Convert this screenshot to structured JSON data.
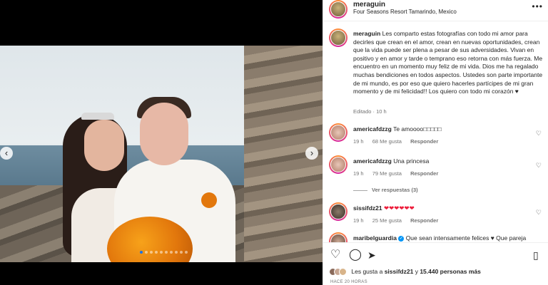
{
  "post": {
    "username": "meraguin",
    "location": "Four Seasons Resort Tamarindo, Mexico",
    "more_label": "•••",
    "caption": "Les comparto estas fotografías con todo mi amor para decirles que crean en el amor, crean en nuevas oportunidades, crean que la vida puede ser plena a pesar de sus adversidades. Vivan en positivo y en amor y tarde o temprano eso retorna con más fuerza. Me encuentro en un momento muy feliz de mi vida. Dios me ha regalado muchas bendiciones en todos aspectos. Ustedes son parte importante de mi mundo, es por eso que quiero hacerles partícipes de mi gran momento y de mi felicidad!! Los quiero con todo mi corazón ♥",
    "edited": "Editado · 10 h"
  },
  "media": {
    "prev": "‹",
    "next": "›",
    "dots_total": 10,
    "dots_active": 1
  },
  "comments": [
    {
      "username": "americafdzzg",
      "text": "Te amoooo□□□□□",
      "time": "19 h",
      "likes": "68 Me gusta",
      "reply": "Responder"
    },
    {
      "username": "americafdzzg",
      "text": "Una princesa",
      "time": "19 h",
      "likes": "79 Me gusta",
      "reply": "Responder"
    },
    {
      "username": "sissifdz21",
      "text": "❤❤❤❤❤❤",
      "time": "19 h",
      "likes": "25 Me gusta",
      "reply": "Responder"
    },
    {
      "username": "maribelguardia",
      "text": "Que sean intensamente felices ♥ Que pareja",
      "verified": true
    }
  ],
  "view_replies": "Ver respuestas (3)",
  "likes": {
    "prefix": "Les gusta a ",
    "user": "sissifdz21",
    "middle": " y ",
    "count": "15.440 personas más"
  },
  "timestamp": "HACE 20 HORAS",
  "icons": {
    "heart": "heart-icon",
    "comment": "comment-icon",
    "share": "paper-plane-icon",
    "save": "bookmark-icon"
  },
  "colors": {
    "accent": "#0095f6",
    "muted": "#737373",
    "heart_red": "#ed1c3a"
  }
}
